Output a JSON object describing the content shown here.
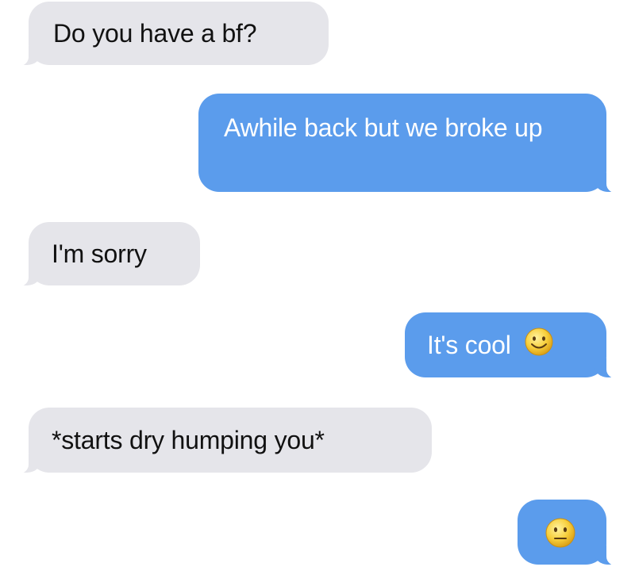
{
  "conversation": {
    "messages": [
      {
        "sender": "them",
        "text": "Do you have a bf?"
      },
      {
        "sender": "me",
        "text": "Awhile back but we broke up"
      },
      {
        "sender": "them",
        "text": "I'm sorry"
      },
      {
        "sender": "me",
        "text": "It's cool",
        "emoji": "smiling-face-icon"
      },
      {
        "sender": "them",
        "text": "*starts dry humping you*"
      },
      {
        "sender": "me",
        "text": "",
        "emoji": "neutral-face-icon"
      }
    ]
  },
  "colors": {
    "incoming_bubble": "#e5e5ea",
    "outgoing_bubble": "#5b9cec",
    "incoming_text": "#111111",
    "outgoing_text": "#ffffff",
    "background": "#ffffff"
  }
}
